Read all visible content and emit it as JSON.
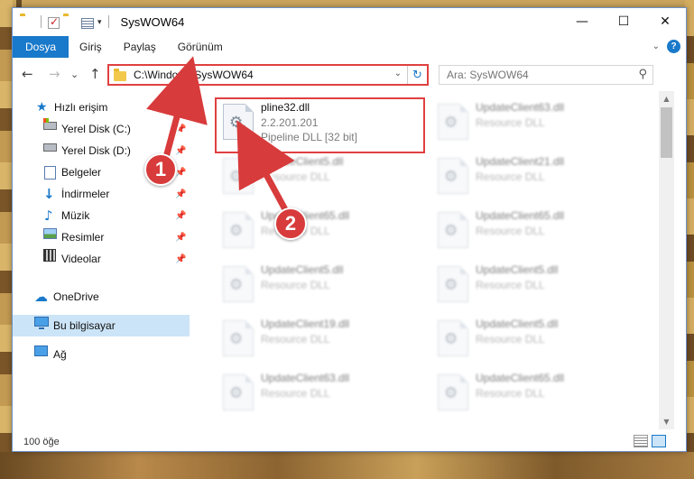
{
  "window": {
    "title": "SysWOW64",
    "controls": {
      "minimize": "—",
      "maximize": "☐",
      "close": "✕"
    }
  },
  "ribbon": {
    "tabs": [
      {
        "label": "Dosya"
      },
      {
        "label": "Giriş"
      },
      {
        "label": "Paylaş"
      },
      {
        "label": "Görünüm"
      }
    ]
  },
  "nav": {
    "back": "←",
    "forward": "→",
    "recent": "⌄",
    "up": "↑",
    "address_path": "C:\\Windows\\SysWOW64",
    "refresh": "↻",
    "search_placeholder": "Ara: SysWOW64"
  },
  "sidebar": {
    "items": [
      {
        "label": "Hızlı erişim",
        "icon": "star-icon"
      },
      {
        "label": "Yerel Disk (C:)",
        "icon": "drive-c-icon"
      },
      {
        "label": "Yerel Disk (D:)",
        "icon": "drive-d-icon"
      },
      {
        "label": "Belgeler",
        "icon": "documents-icon"
      },
      {
        "label": "İndirmeler",
        "icon": "downloads-icon"
      },
      {
        "label": "Müzik",
        "icon": "music-icon"
      },
      {
        "label": "Resimler",
        "icon": "pictures-icon"
      },
      {
        "label": "Videolar",
        "icon": "videos-icon"
      },
      {
        "label": "OneDrive",
        "icon": "onedrive-icon"
      },
      {
        "label": "Bu bilgisayar",
        "icon": "this-pc-icon",
        "selected": true
      },
      {
        "label": "Ağ",
        "icon": "network-icon"
      }
    ]
  },
  "files": {
    "highlighted": {
      "name": "pline32.dll",
      "version": "2.2.201.201",
      "type": "Pipeline DLL [32 bit]"
    },
    "others": [
      {
        "name": "UpdateClient63.dll",
        "type": "Resource DLL"
      },
      {
        "name": "UpdateClient5.dll",
        "type": "Resource DLL"
      },
      {
        "name": "UpdateClient21.dll",
        "type": "Resource DLL"
      },
      {
        "name": "UpdateClient65.dll",
        "type": "Resource DLL"
      },
      {
        "name": "UpdateClient65.dll",
        "type": "Resource DLL"
      },
      {
        "name": "UpdateClient5.dll",
        "type": "Resource DLL"
      },
      {
        "name": "UpdateClient5.dll",
        "type": "Resource DLL"
      },
      {
        "name": "UpdateClient19.dll",
        "type": "Resource DLL"
      },
      {
        "name": "UpdateClient5.dll",
        "type": "Resource DLL"
      },
      {
        "name": "UpdateClient63.dll",
        "type": "Resource DLL"
      },
      {
        "name": "UpdateClient65.dll",
        "type": "Resource DLL"
      }
    ]
  },
  "status": {
    "item_count": "100 öğe"
  },
  "callouts": [
    {
      "number": "1"
    },
    {
      "number": "2"
    }
  ],
  "colors": {
    "accent": "#1979ca",
    "callout": "#d83b3b",
    "selection": "#cce4f7"
  }
}
